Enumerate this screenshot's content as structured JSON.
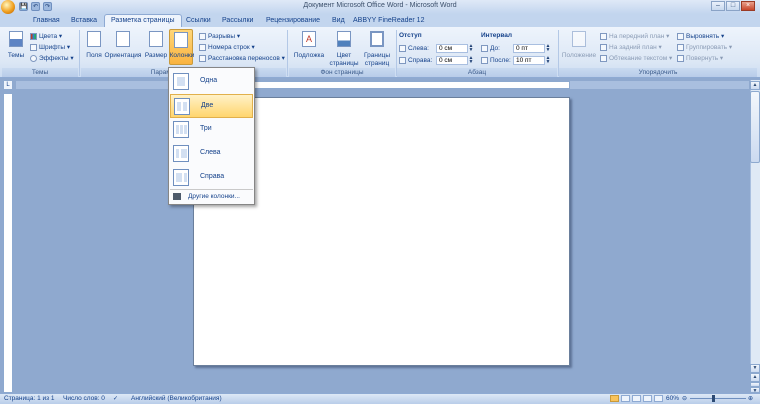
{
  "window": {
    "title": "Документ Microsoft Office Word - Microsoft Word",
    "minimize": "–",
    "maximize": "□",
    "close": "×"
  },
  "qat": {
    "save": "💾",
    "undo": "↶",
    "redo": "↷"
  },
  "tabs": [
    {
      "label": "Главная"
    },
    {
      "label": "Вставка"
    },
    {
      "label": "Разметка страницы",
      "active": true
    },
    {
      "label": "Ссылки"
    },
    {
      "label": "Рассылки"
    },
    {
      "label": "Рецензирование"
    },
    {
      "label": "Вид"
    },
    {
      "label": "ABBYY FineReader 12"
    }
  ],
  "ribbon": {
    "themes": {
      "group": "Темы",
      "themes_btn": "Темы",
      "colors": "Цвета ▾",
      "fonts": "Шрифты ▾",
      "effects": "Эффекты ▾"
    },
    "page_setup": {
      "group": "Параметры страницы",
      "margins": "Поля",
      "orientation": "Ориентация",
      "size": "Размер",
      "columns": "Колонки",
      "breaks": "Разрывы ▾",
      "line_numbers": "Номера строк ▾",
      "hyphenation": "Расстановка переносов ▾"
    },
    "page_background": {
      "group": "Фон страницы",
      "watermark": "Подложка",
      "page_color_1": "Цвет",
      "page_color_2": "страницы",
      "page_borders_1": "Границы",
      "page_borders_2": "страниц"
    },
    "paragraph": {
      "group": "Абзац",
      "indent_title": "Отступ",
      "left_label": "Слева:",
      "left_value": "0 см",
      "right_label": "Справа:",
      "right_value": "0 см",
      "spacing_title": "Интервал",
      "before_label": "До:",
      "before_value": "0 пт",
      "after_label": "После:",
      "after_value": "10 пт"
    },
    "arrange": {
      "group": "Упорядочить",
      "position": "Положение",
      "bring_front": "На передний план ▾",
      "send_back": "На задний план ▾",
      "wrap_text": "Обтекание текстом ▾",
      "align": "Выровнять ▾",
      "group_btn": "Группировать ▾",
      "rotate": "Повернуть ▾"
    }
  },
  "columns_menu": {
    "items": [
      {
        "label": "Одна"
      },
      {
        "label": "Две",
        "selected": true
      },
      {
        "label": "Три"
      },
      {
        "label": "Слева"
      },
      {
        "label": "Справа"
      }
    ],
    "more": "Другие колонки..."
  },
  "ruler_corner": "L",
  "statusbar": {
    "page": "Страница: 1 из 1",
    "words": "Число слов: 0",
    "language": "Английский (Великобритания)",
    "zoom": "60%"
  }
}
